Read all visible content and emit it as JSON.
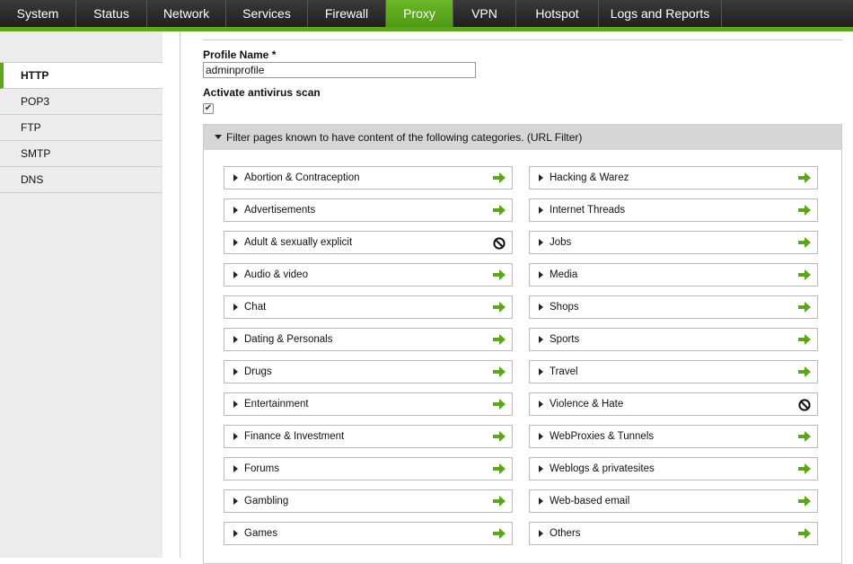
{
  "topnav": {
    "tabs": [
      {
        "label": "System",
        "w": 85
      },
      {
        "label": "Status",
        "w": 79
      },
      {
        "label": "Network",
        "w": 88
      },
      {
        "label": "Services",
        "w": 91
      },
      {
        "label": "Firewall",
        "w": 87
      },
      {
        "label": "Proxy",
        "w": 75
      },
      {
        "label": "VPN",
        "w": 70
      },
      {
        "label": "Hotspot",
        "w": 92
      },
      {
        "label": "Logs and Reports",
        "w": 137
      }
    ],
    "active": "Proxy"
  },
  "sidebar": {
    "items": [
      "HTTP",
      "POP3",
      "FTP",
      "SMTP",
      "DNS"
    ],
    "active": "HTTP"
  },
  "form": {
    "profile_name_label": "Profile Name *",
    "profile_name_value": "adminprofile",
    "antivirus_label": "Activate antivirus scan",
    "antivirus_checked": true
  },
  "filter": {
    "header": "Filter pages known to have content of the following categories. (URL Filter)",
    "left": [
      {
        "name": "Abortion & Contraception",
        "action": "allow"
      },
      {
        "name": "Advertisements",
        "action": "allow"
      },
      {
        "name": "Adult & sexually explicit",
        "action": "block"
      },
      {
        "name": "Audio & video",
        "action": "allow"
      },
      {
        "name": "Chat",
        "action": "allow"
      },
      {
        "name": "Dating & Personals",
        "action": "allow"
      },
      {
        "name": "Drugs",
        "action": "allow"
      },
      {
        "name": "Entertainment",
        "action": "allow"
      },
      {
        "name": "Finance & Investment",
        "action": "allow"
      },
      {
        "name": "Forums",
        "action": "allow"
      },
      {
        "name": "Gambling",
        "action": "allow"
      },
      {
        "name": "Games",
        "action": "allow"
      }
    ],
    "right": [
      {
        "name": "Hacking & Warez",
        "action": "allow"
      },
      {
        "name": "Internet Threads",
        "action": "allow"
      },
      {
        "name": "Jobs",
        "action": "allow"
      },
      {
        "name": "Media",
        "action": "allow"
      },
      {
        "name": "Shops",
        "action": "allow"
      },
      {
        "name": "Sports",
        "action": "allow"
      },
      {
        "name": "Travel",
        "action": "allow"
      },
      {
        "name": "Violence & Hate",
        "action": "block"
      },
      {
        "name": "WebProxies & Tunnels",
        "action": "allow"
      },
      {
        "name": "Weblogs & privatesites",
        "action": "allow"
      },
      {
        "name": "Web-based email",
        "action": "allow"
      },
      {
        "name": "Others",
        "action": "allow"
      }
    ]
  },
  "colors": {
    "accent": "#5aa818",
    "allow_arrow": "#5aa818",
    "block": "#111111"
  }
}
